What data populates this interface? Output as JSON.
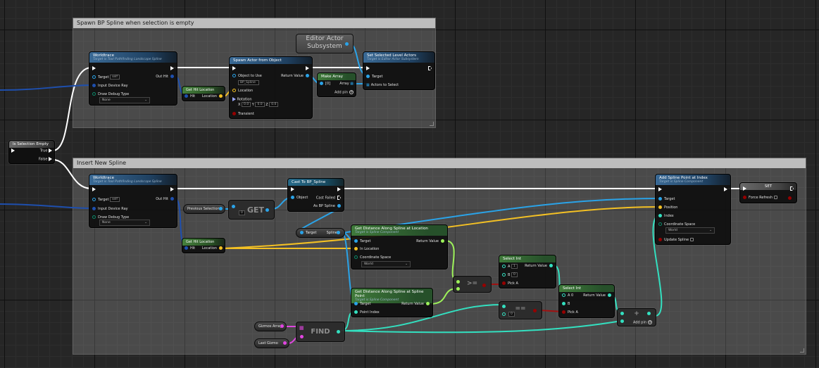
{
  "comments": {
    "spawn": "Spawn BP Spline when selection is empty",
    "insert": "Insert New Spline"
  },
  "branch": {
    "title": "Is Selection Empty",
    "true": "True",
    "false": "False"
  },
  "worldtrace1": {
    "title": "Worldtrace",
    "sub": "Target is Tool Pathfinding Landscape Spline",
    "target": "Target",
    "target_val": "self",
    "out_hit": "Out Hit",
    "input_ray": "Input Device Ray",
    "draw_debug": "Draw Debug Type",
    "draw_debug_val": "None"
  },
  "worldtrace2": {
    "title": "Worldtrace",
    "sub": "Target is Tool Pathfinding Landscape Spline",
    "target": "Target",
    "target_val": "self",
    "out_hit": "Out Hit",
    "input_ray": "Input Device Ray",
    "draw_debug": "Draw Debug Type",
    "draw_debug_val": "None"
  },
  "gethit1": {
    "title": "Get Hit Location",
    "hit": "Hit",
    "location": "Location"
  },
  "gethit2": {
    "title": "Get Hit Location",
    "hit": "Hit",
    "location": "Location"
  },
  "spawn_actor": {
    "title": "Spawn Actor from Object",
    "object": "Object to Use",
    "object_val": "BP_Spline",
    "return": "Return Value",
    "location": "Location",
    "rotation": "Rotation",
    "rx_label": "X",
    "rx": "0.0",
    "ry_label": "Y",
    "ry": "0.0",
    "rz_label": "Z",
    "rz": "0.0",
    "transient": "Transient"
  },
  "subsystem": {
    "line1": "Editor Actor",
    "line2": "Subsystem"
  },
  "make_array": {
    "title": "Make Array",
    "item0": "[0]",
    "array": "Array",
    "add_pin": "Add pin"
  },
  "set_selected": {
    "title": "Set Selected Level Actors",
    "sub": "Target is Editor Actor Subsystem",
    "target": "Target",
    "actors": "Actors to Select"
  },
  "prev_selection": "Previous Selection",
  "get_node": {
    "label": "GET",
    "index": "0"
  },
  "cast": {
    "title": "Cast To BP_Spline",
    "object": "Object",
    "cast_failed": "Cast Failed",
    "as": "As BP Spline"
  },
  "spline_getter": {
    "target": "Target",
    "spline": "Spline"
  },
  "dist_loc": {
    "title": "Get Distance Along Spline at Location",
    "sub": "Target is Spline Component",
    "target": "Target",
    "return": "Return Value",
    "in_loc": "In Location",
    "coord": "Coordinate Space",
    "coord_val": "World"
  },
  "dist_point": {
    "title": "Get Distance Along Spline at Spline Point",
    "sub": "Target is Spline Component",
    "target": "Target",
    "return": "Return Value",
    "point_index": "Point Index"
  },
  "ge_node": {
    "label": ">="
  },
  "eq_node": {
    "label": "==",
    "b": "0"
  },
  "select1": {
    "title": "Select Int",
    "a": "A",
    "a_val": "1",
    "b": "B",
    "b_val": "0",
    "return": "Return Value",
    "pick": "Pick A"
  },
  "select2": {
    "title": "Select Int",
    "a": "A",
    "a_val": "0",
    "b": "B",
    "return": "Return Value",
    "pick": "Pick A"
  },
  "add_node": {
    "label": "+",
    "add_pin": "Add pin"
  },
  "find_node": {
    "label": "FIND"
  },
  "gizmos_array": "Gizmos Array",
  "last_gizmo": "Last Gizmo",
  "add_spline_point": {
    "title": "Add Spline Point at Index",
    "sub": "Target is Spline Component",
    "target": "Target",
    "position": "Position",
    "index": "Index",
    "coord": "Coordinate Space",
    "coord_val": "World",
    "update": "Update Spline"
  },
  "set_node": {
    "title": "SET",
    "force": "Force Refresh"
  },
  "colors": {
    "exec": "#ffffff",
    "object": "#2aa3e8",
    "vector": "#f3c024",
    "float": "#9df25a",
    "int": "#33e0c0",
    "bool": "#960000",
    "struct": "#2a63c8",
    "array": "#e045e0"
  }
}
